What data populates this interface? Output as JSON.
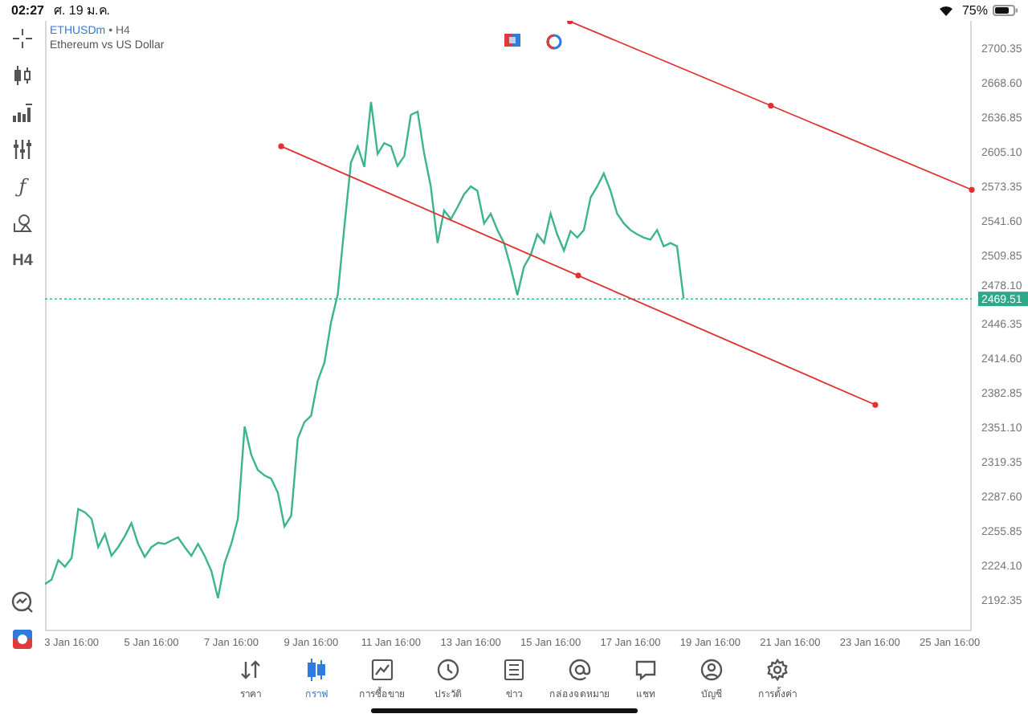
{
  "status_bar": {
    "time": "02:27",
    "date": "ศ. 19 ม.ค.",
    "battery": "75%"
  },
  "toolbar": [
    {
      "kind": "crosshair"
    },
    {
      "kind": "candles"
    },
    {
      "kind": "volume"
    },
    {
      "kind": "indicators"
    },
    {
      "kind": "text",
      "label": "ƒ"
    },
    {
      "kind": "objects"
    },
    {
      "kind": "text",
      "label": "H4"
    }
  ],
  "header": {
    "symbol": "ETHUSDm",
    "separator": "•",
    "timeframe": "H4",
    "description": "Ethereum vs US Dollar"
  },
  "chart_data": {
    "type": "line",
    "ylim": [
      2163.5,
      2725.5
    ],
    "categories": [
      null,
      null,
      null,
      null,
      "3 Jan 16:00",
      null,
      null,
      null,
      null,
      null,
      null,
      null,
      null,
      null,
      null,
      null,
      "5 Jan 16:00",
      null,
      null,
      null,
      null,
      null,
      null,
      null,
      null,
      null,
      null,
      null,
      "7 Jan 16:00",
      null,
      null,
      null,
      null,
      null,
      null,
      null,
      null,
      null,
      null,
      null,
      "9 Jan 16:00",
      null,
      null,
      null,
      null,
      null,
      null,
      null,
      null,
      null,
      null,
      null,
      "11 Jan 16:00",
      null,
      null,
      null,
      null,
      null,
      null,
      null,
      null,
      null,
      null,
      null,
      "13 Jan 16:00",
      null,
      null,
      null,
      null,
      null,
      null,
      null,
      null,
      null,
      null,
      null,
      "15 Jan 16:00",
      null,
      null,
      null,
      null,
      null,
      null,
      null,
      null,
      null,
      null,
      null,
      "17 Jan 16:00",
      null,
      null,
      null,
      null,
      null,
      null,
      null,
      null,
      null,
      null,
      null,
      "19 Jan 16:00",
      null,
      null,
      null,
      null,
      null,
      null,
      null,
      null,
      null,
      null,
      null,
      "21 Jan 16:00",
      null,
      null,
      null,
      null,
      null,
      null,
      null,
      null,
      null,
      null,
      null,
      "23 Jan 16:00",
      null,
      null,
      null,
      null,
      null,
      null,
      null,
      null,
      null,
      null,
      null,
      "25 Jan 16:00",
      null,
      null,
      null
    ],
    "series": [
      {
        "color": "#3cb58a",
        "values": [
          2207,
          2211,
          2229,
          2223,
          2231,
          2276,
          2273,
          2267,
          2241,
          2253,
          2233,
          2241,
          2251,
          2263,
          2244,
          2232,
          2241,
          2245,
          2244,
          2247,
          2250,
          2241,
          2233,
          2244,
          2233,
          2219,
          2194,
          2226,
          2244,
          2267,
          2352,
          2326,
          2312,
          2307,
          2304,
          2291,
          2260,
          2270,
          2341,
          2356,
          2362,
          2394,
          2411,
          2448,
          2474,
          2536,
          2595,
          2610,
          2591,
          2651,
          2603,
          2613,
          2610,
          2592,
          2601,
          2639,
          2642,
          2603,
          2573,
          2521,
          2551,
          2543,
          2554,
          2566,
          2573,
          2569,
          2539,
          2548,
          2533,
          2521,
          2499,
          2473,
          2499,
          2510,
          2529,
          2521,
          2548,
          2529,
          2514,
          2532,
          2526,
          2533,
          2563,
          2573,
          2585,
          2569,
          2548,
          2539,
          2533,
          2529,
          2526,
          2524,
          2533,
          2518,
          2521,
          2518,
          2470,
          null,
          null,
          null,
          null,
          null,
          null,
          null,
          null,
          null,
          null,
          null,
          null,
          null,
          null,
          null,
          null,
          null,
          null,
          null,
          null,
          null,
          null,
          null,
          null,
          null,
          null,
          null,
          null,
          null,
          null,
          null,
          null,
          null,
          null,
          null,
          null,
          null,
          null,
          null,
          null,
          null,
          null,
          null
        ]
      }
    ],
    "yticks": [
      {
        "value": 2700.35,
        "label": "2700.35"
      },
      {
        "value": 2668.6,
        "label": "2668.60"
      },
      {
        "value": 2636.85,
        "label": "2636.85"
      },
      {
        "value": 2605.1,
        "label": "2605.10"
      },
      {
        "value": 2573.35,
        "label": "2573.35"
      },
      {
        "value": 2541.6,
        "label": "2541.60"
      },
      {
        "value": 2509.85,
        "label": "2509.85"
      },
      {
        "value": 2478.1,
        "label": "2478.10"
      },
      {
        "value": 2446.35,
        "label": "2446.35"
      },
      {
        "value": 2414.6,
        "label": "2414.60"
      },
      {
        "value": 2382.85,
        "label": "2382.85"
      },
      {
        "value": 2351.1,
        "label": "2351.10"
      },
      {
        "value": 2319.35,
        "label": "2319.35"
      },
      {
        "value": 2287.6,
        "label": "2287.60"
      },
      {
        "value": 2255.85,
        "label": "2255.85"
      },
      {
        "value": 2224.1,
        "label": "2224.10"
      },
      {
        "value": 2192.35,
        "label": "2192.35"
      }
    ]
  },
  "current_price": {
    "label": "2469.51"
  },
  "tabs": [
    {
      "label": "ราคา",
      "selected": false
    },
    {
      "label": "กราฟ",
      "selected": true
    },
    {
      "label": "การซื้อขาย",
      "selected": false
    },
    {
      "label": "ประวัติ",
      "selected": false
    },
    {
      "label": "ข่าว",
      "selected": false
    },
    {
      "label": "กล่องจดหมาย",
      "selected": false
    },
    {
      "label": "แชท",
      "selected": false
    },
    {
      "label": "บัญชี",
      "selected": false
    },
    {
      "label": "การตั้งค่า",
      "selected": false
    }
  ]
}
